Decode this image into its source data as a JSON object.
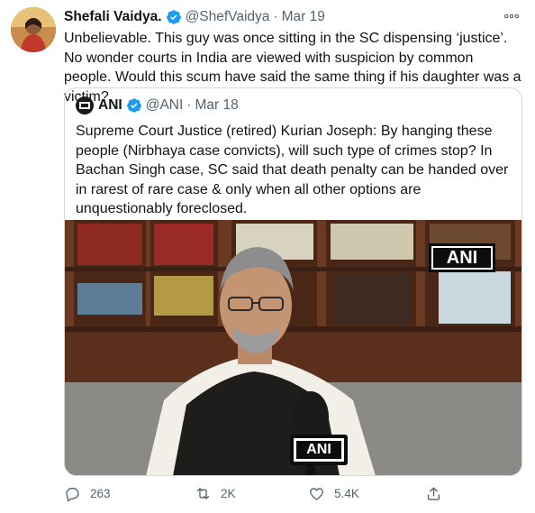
{
  "author": {
    "name": "Shefali Vaidya.",
    "handle": "@ShefVaidya",
    "separator": "·",
    "date": "Mar 19"
  },
  "tweet_text": "Unbelievable. This guy was once sitting in the SC dispensing ‘justice’. No wonder courts in India are viewed with suspicion by common people. Would this scum have said the same thing if his daughter was a victim?",
  "quoted": {
    "name": "ANI",
    "handle": "@ANI",
    "separator": "·",
    "date": "Mar 18",
    "text": "Supreme Court Justice (retired) Kurian Joseph: By hanging these people (Nirbhaya case convicts), will such type of crimes stop? In Bachan Singh case, SC said that death penalty can be handed over in rarest of rare case & only when all other options are unquestionably foreclosed.",
    "media": {
      "watermark": "ANI",
      "mic_label": "ANI"
    }
  },
  "actions": {
    "reply_count": "263",
    "retweet_count": "2K",
    "like_count": "5.4K"
  },
  "colors": {
    "verified": "#1d9bf0",
    "muted_text": "#536471",
    "border": "#cfd9de"
  },
  "icons": [
    "verified-icon",
    "more-icon",
    "reply-icon",
    "retweet-icon",
    "like-icon",
    "share-icon"
  ]
}
